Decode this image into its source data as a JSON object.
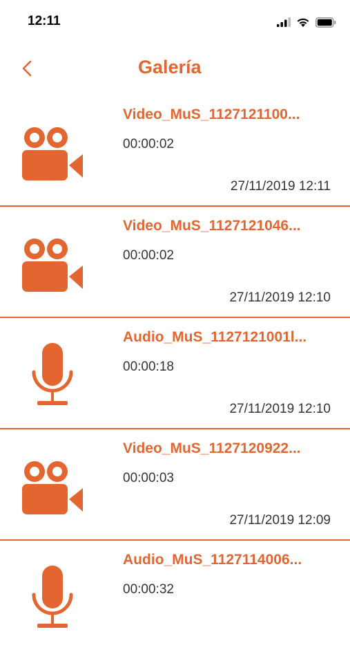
{
  "status_bar": {
    "time": "12:11"
  },
  "header": {
    "title": "Galería",
    "back_icon": "chevron-left-icon"
  },
  "colors": {
    "accent": "#e3652f",
    "text": "#333333",
    "background": "#ffffff"
  },
  "items": [
    {
      "type": "video",
      "icon": "video-camera-icon",
      "title": "Video_MuS_1127121100...",
      "duration": "00:00:02",
      "date": "27/11/2019 12:11"
    },
    {
      "type": "video",
      "icon": "video-camera-icon",
      "title": "Video_MuS_1127121046...",
      "duration": "00:00:02",
      "date": "27/11/2019 12:10"
    },
    {
      "type": "audio",
      "icon": "microphone-icon",
      "title": "Audio_MuS_1127121001l...",
      "duration": "00:00:18",
      "date": "27/11/2019 12:10"
    },
    {
      "type": "video",
      "icon": "video-camera-icon",
      "title": "Video_MuS_1127120922...",
      "duration": "00:00:03",
      "date": "27/11/2019 12:09"
    },
    {
      "type": "audio",
      "icon": "microphone-icon",
      "title": "Audio_MuS_1127114006...",
      "duration": "00:00:32",
      "date": ""
    }
  ]
}
